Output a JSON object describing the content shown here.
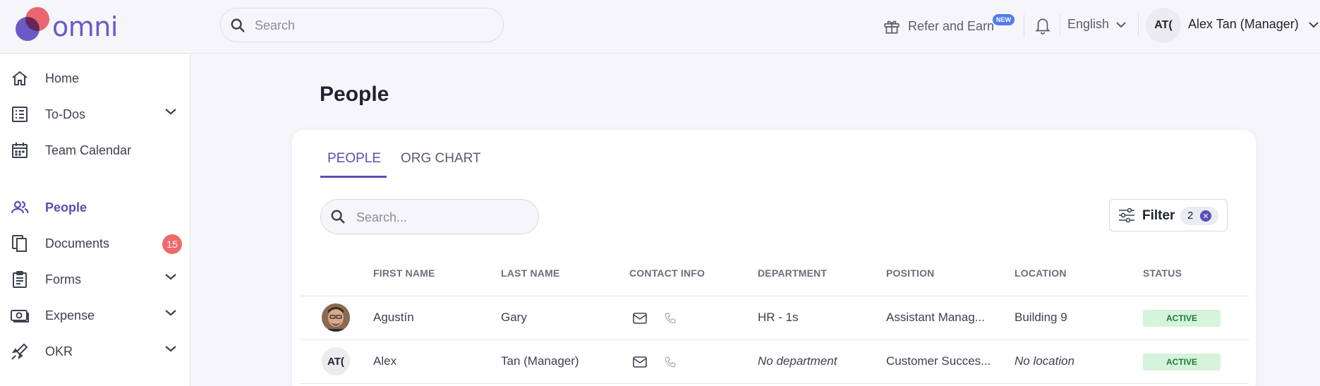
{
  "app": {
    "logo_text": "omni"
  },
  "topbar": {
    "search_placeholder": "Search",
    "refer_label": "Refer and Earn",
    "new_badge": "NEW",
    "language": "English",
    "avatar_initials": "AT(",
    "user_name": "Alex Tan (Manager)"
  },
  "sidebar": {
    "items": [
      {
        "label": "Home"
      },
      {
        "label": "To-Dos"
      },
      {
        "label": "Team Calendar"
      },
      {
        "label": "People"
      },
      {
        "label": "Documents",
        "badge": "15"
      },
      {
        "label": "Forms"
      },
      {
        "label": "Expense"
      },
      {
        "label": "OKR"
      }
    ]
  },
  "main": {
    "title": "People",
    "tabs": [
      {
        "label": "PEOPLE"
      },
      {
        "label": "ORG CHART"
      }
    ],
    "search_placeholder": "Search...",
    "filter_label": "Filter",
    "filter_count": "2",
    "columns": [
      "FIRST NAME",
      "LAST NAME",
      "CONTACT INFO",
      "DEPARTMENT",
      "POSITION",
      "LOCATION",
      "STATUS"
    ],
    "rows": [
      {
        "first": "Agustín",
        "last": "Gary",
        "department": "HR - 1s",
        "position": "Assistant Manag...",
        "location": "Building 9",
        "status": "ACTIVE"
      },
      {
        "initials": "AT(",
        "first": "Alex",
        "last": "Tan (Manager)",
        "department": "No department",
        "position": "Customer Succes...",
        "location": "No location",
        "status": "ACTIVE"
      }
    ]
  },
  "colors": {
    "accent": "#5a4fb5",
    "badge_red": "#f06a6a",
    "status_green_bg": "#d6f3dc"
  }
}
